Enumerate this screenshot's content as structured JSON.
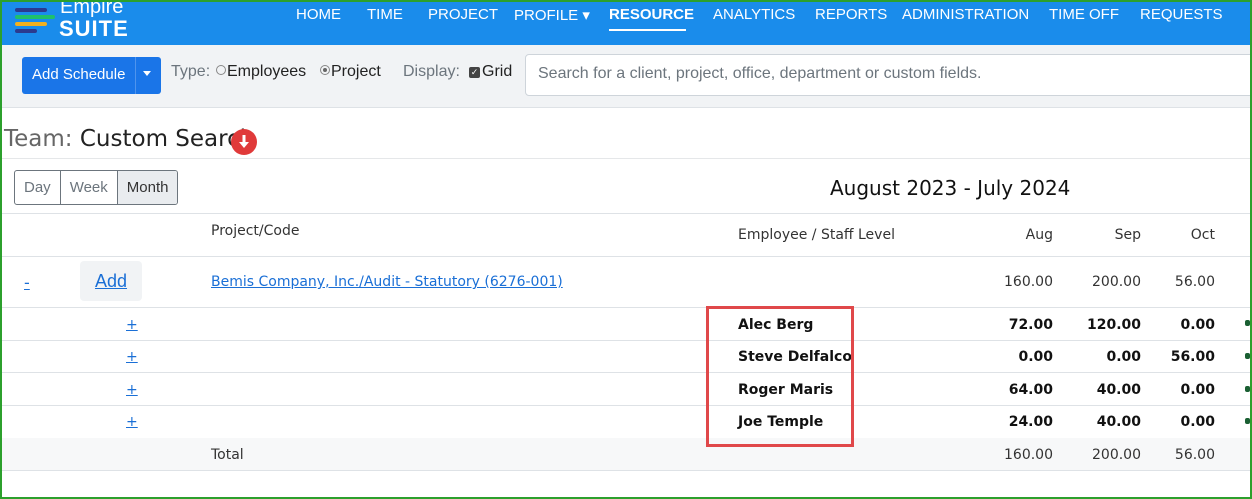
{
  "app": {
    "brand_line1": "Empire",
    "brand_line2": "SUITE"
  },
  "nav": {
    "items": [
      {
        "label": "HOME"
      },
      {
        "label": "TIME"
      },
      {
        "label": "PROJECT"
      },
      {
        "label": "PROFILE ▾"
      },
      {
        "label": "RESOURCE"
      },
      {
        "label": "ANALYTICS"
      },
      {
        "label": "REPORTS"
      },
      {
        "label": "ADMINISTRATION"
      },
      {
        "label": "TIME OFF"
      },
      {
        "label": "REQUESTS"
      }
    ],
    "active": "RESOURCE"
  },
  "toolbar": {
    "add_schedule": "Add Schedule",
    "type_label": "Type:",
    "type_options": [
      "Employees",
      "Project"
    ],
    "type_selected": "Project",
    "display_label": "Display:",
    "display_option": "Grid",
    "search_placeholder": "Search for a client, project, office, department or custom fields."
  },
  "team": {
    "label": "Team:",
    "value": "Custom Search"
  },
  "views": {
    "items": [
      "Day",
      "Week",
      "Month"
    ],
    "active": "Month"
  },
  "date_range": "August 2023 - July 2024",
  "table": {
    "headers": {
      "project": "Project/Code",
      "employee": "Employee / Staff Level",
      "months": [
        "Aug",
        "Sep",
        "Oct"
      ]
    },
    "project_row": {
      "collapse": "-",
      "add": "Add",
      "project": "Bemis Company, Inc./Audit - Statutory (6276-001)",
      "values": [
        "160.00",
        "200.00",
        "56.00"
      ]
    },
    "rows": [
      {
        "expand": "+",
        "employee": "Alec Berg",
        "values": [
          "72.00",
          "120.00",
          "0.00"
        ]
      },
      {
        "expand": "+",
        "employee": "Steve Delfalco",
        "values": [
          "0.00",
          "0.00",
          "56.00"
        ]
      },
      {
        "expand": "+",
        "employee": "Roger Maris",
        "values": [
          "64.00",
          "40.00",
          "0.00"
        ]
      },
      {
        "expand": "+",
        "employee": "Joe Temple",
        "values": [
          "24.00",
          "40.00",
          "0.00"
        ]
      }
    ],
    "total_row": {
      "label": "Total",
      "values": [
        "160.00",
        "200.00",
        "56.00"
      ]
    }
  },
  "colors": {
    "nav_bg": "#1a8ceb",
    "primary_button": "#1a75e8",
    "highlight_box": "#e0484a",
    "frame": "#2ca02c",
    "alert_icon": "#e03a3a"
  }
}
